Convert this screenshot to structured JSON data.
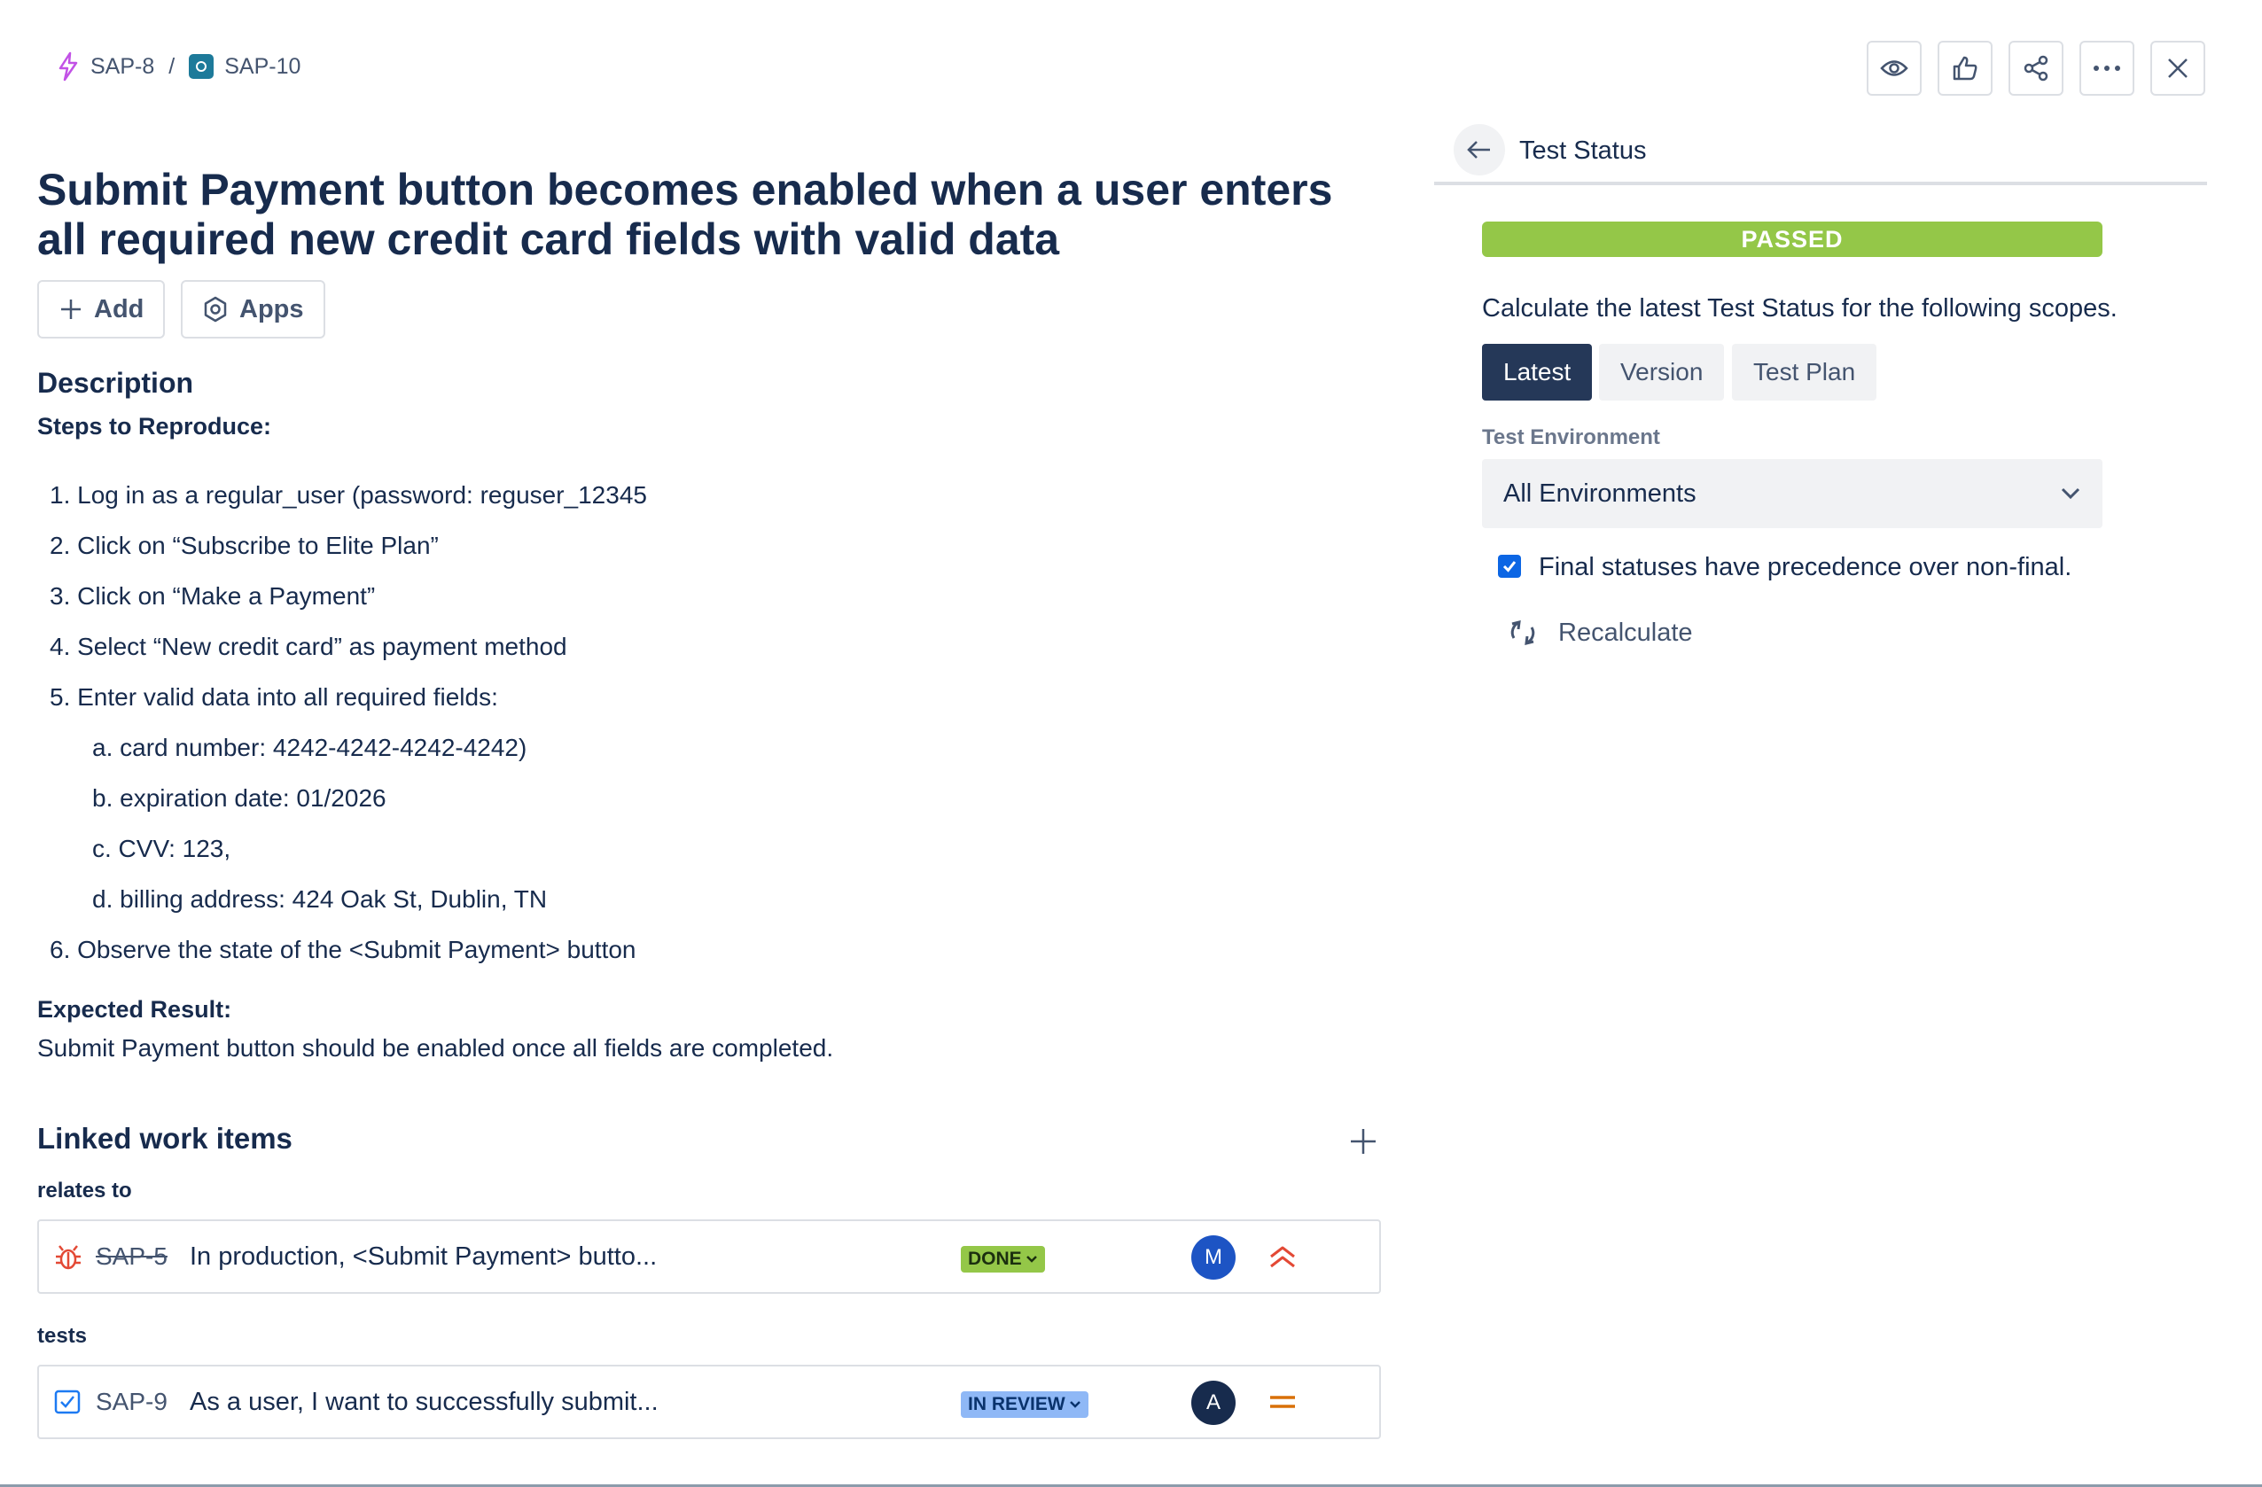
{
  "breadcrumb": {
    "parent_key": "SAP-8",
    "separator": "/",
    "current_key": "SAP-10",
    "parent_icon": "lightning-icon",
    "current_icon": "test-icon"
  },
  "top_actions": [
    "eye-icon",
    "thumbs-up-icon",
    "share-icon",
    "more-icon",
    "close-icon"
  ],
  "issue": {
    "title": "Submit Payment button becomes enabled when a user enters all required new credit card fields with valid data",
    "add_label": "Add",
    "apps_label": "Apps"
  },
  "description": {
    "heading": "Description",
    "steps_heading": "Steps to Reproduce:",
    "steps": [
      "1. Log in as a regular_user (password: reguser_12345",
      "2. Click on “Subscribe to Elite Plan”",
      "3. Click on “Make a Payment”",
      "4. Select “New credit card” as payment method",
      "5. Enter valid data into all required fields:",
      "a. card number: 4242-4242-4242-4242)",
      "b. expiration date: 01/2026",
      "c. CVV: 123,",
      "d. billing address: 424 Oak St, Dublin, TN",
      "6. Observe the state of the <Submit Payment> button"
    ],
    "expected_heading": "Expected Result:",
    "expected_text": "Submit Payment button should be enabled once all fields are completed."
  },
  "linked": {
    "heading": "Linked work items",
    "groups": [
      {
        "label": "relates to",
        "item": {
          "type_icon": "bug-icon",
          "key": "SAP-5",
          "summary": "In production, <Submit Payment> butto...",
          "status": "DONE",
          "status_color": "#94c748",
          "avatar": "M",
          "avatar_color": "#1d54c4",
          "priority_icon": "highest-priority-icon"
        }
      },
      {
        "label": "tests",
        "item": {
          "type_icon": "checkbox-icon",
          "key": "SAP-9",
          "summary": "As a user, I want to successfully submit...",
          "status": "IN REVIEW",
          "status_color": "#8fb8f6",
          "avatar": "A",
          "avatar_color": "#172b4d",
          "priority_icon": "medium-priority-icon"
        }
      }
    ]
  },
  "panel": {
    "title": "Test Status",
    "status": "PASSED",
    "status_color": "#94c748",
    "calc_text": "Calculate the latest Test Status for the following scopes.",
    "scopes": [
      "Latest",
      "Version",
      "Test Plan"
    ],
    "active_scope": "Latest",
    "env_label": "Test Environment",
    "env_value": "All Environments",
    "checkbox_label": "Final statuses have precedence over non-final.",
    "checkbox_checked": true,
    "recalc_label": "Recalculate"
  }
}
